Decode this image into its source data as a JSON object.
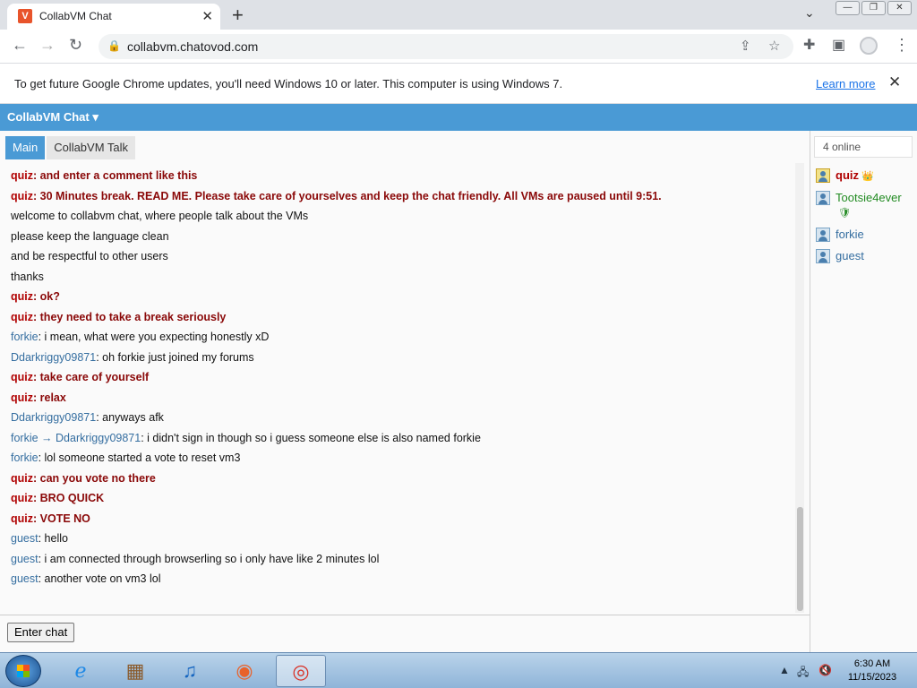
{
  "browser": {
    "tab_title": "CollabVM Chat",
    "tab_favicon_letter": "V",
    "url": "collabvm.chatovod.com",
    "infobar_text": "To get future Google Chrome updates, you'll need Windows 10 or later. This computer is using Windows 7.",
    "infobar_link": "Learn more"
  },
  "app": {
    "title": "CollabVM Chat ▾",
    "tabs": [
      "Main",
      "CollabVM Talk"
    ],
    "enter_chat": "Enter chat"
  },
  "messages": [
    {
      "user": "quiz",
      "sep": ": ",
      "text": "and enter a comment like this",
      "admin": true
    },
    {
      "user": "quiz",
      "sep": ": ",
      "text": "30 Minutes break. READ ME. Please take care of yourselves and keep the chat friendly. All VMs are paused until 9:51.",
      "admin": true
    },
    {
      "user": "",
      "sep": "",
      "text": "welcome to collabvm chat, where people talk about the VMs",
      "admin": false
    },
    {
      "user": "",
      "sep": "",
      "text": "please keep the language clean",
      "admin": false
    },
    {
      "user": "",
      "sep": "",
      "text": "and be respectful to other users",
      "admin": false
    },
    {
      "user": "",
      "sep": "",
      "text": "thanks",
      "admin": false
    },
    {
      "user": "quiz",
      "sep": ": ",
      "text": "ok?",
      "admin": true
    },
    {
      "user": "quiz",
      "sep": ": ",
      "text": "they need to take a break seriously",
      "admin": true
    },
    {
      "user": "forkie",
      "sep": ": ",
      "text": "i mean, what were you expecting honestly xD",
      "admin": false
    },
    {
      "user": "Ddarkriggy09871",
      "sep": ": ",
      "text": "oh forkie just joined my forums",
      "admin": false
    },
    {
      "user": "quiz",
      "sep": ": ",
      "text": "take care of yourself",
      "admin": true
    },
    {
      "user": "quiz",
      "sep": ": ",
      "text": "relax",
      "admin": true
    },
    {
      "user": "Ddarkriggy09871",
      "sep": ": ",
      "text": "anyways afk",
      "admin": false
    },
    {
      "user": "forkie → Ddarkriggy09871",
      "sep": ": ",
      "text": "i didn't sign in though so i guess someone else is also named forkie",
      "admin": false
    },
    {
      "user": "forkie",
      "sep": ": ",
      "text": "lol someone started a vote to reset vm3",
      "admin": false
    },
    {
      "user": "quiz",
      "sep": ": ",
      "text": "can you vote no there",
      "admin": true
    },
    {
      "user": "quiz",
      "sep": ": ",
      "text": "BRO QUICK",
      "admin": true
    },
    {
      "user": "quiz",
      "sep": ": ",
      "text": "VOTE NO",
      "admin": true
    },
    {
      "user": "guest",
      "sep": ": ",
      "text": "hello",
      "admin": false
    },
    {
      "user": "guest",
      "sep": ": ",
      "text": "i am connected through browserling so i only have like 2 minutes lol",
      "admin": false
    },
    {
      "user": "guest",
      "sep": ": ",
      "text": "another vote on vm3 lol",
      "admin": false
    }
  ],
  "users_panel": {
    "online_count": "4 online",
    "users": [
      {
        "name": "quiz",
        "role": "admin",
        "badge": "👑"
      },
      {
        "name": "Tootsie4ever",
        "role": "mod",
        "badge": "🛡"
      },
      {
        "name": "forkie",
        "role": "user",
        "badge": ""
      },
      {
        "name": "guest",
        "role": "user",
        "badge": ""
      }
    ]
  },
  "taskbar": {
    "time": "6:30 AM",
    "date": "11/15/2023"
  }
}
